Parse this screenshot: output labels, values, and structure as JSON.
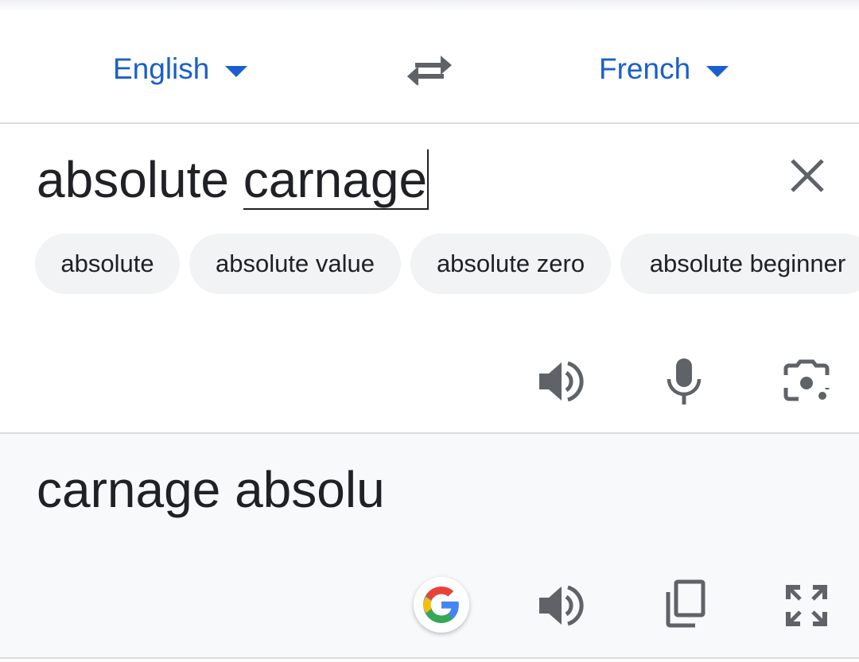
{
  "language_bar": {
    "source_language": "English",
    "target_language": "French",
    "swap_icon": "swap-arrows-icon"
  },
  "input": {
    "text_plain": "absolute ",
    "text_composing": "carnage",
    "clear_icon": "close-icon",
    "suggestions": [
      "absolute",
      "absolute value",
      "absolute zero",
      "absolute beginner"
    ],
    "actions": [
      "speaker-icon",
      "microphone-icon",
      "camera-lens-icon"
    ]
  },
  "output": {
    "translation": "carnage absolu",
    "actions": [
      "google-g-icon",
      "speaker-icon",
      "copy-icon",
      "fullscreen-icon"
    ]
  },
  "colors": {
    "accent": "#1a5fcc",
    "icon": "#5f6368",
    "output_bg": "#f8f9fa",
    "chip_bg": "#f1f3f4"
  }
}
